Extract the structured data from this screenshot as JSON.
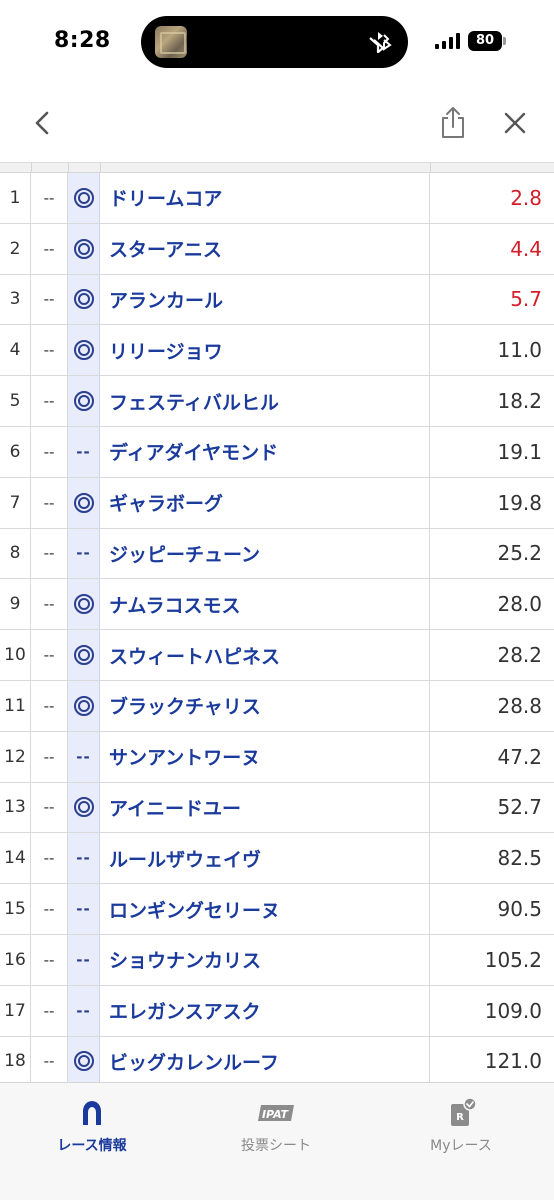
{
  "status_bar": {
    "time": "8:28",
    "battery": "80",
    "island_icons": [
      "media-thumbnail-icon",
      "bluetooth-icon"
    ]
  },
  "nav": {
    "back_icon": "chevron-left-icon",
    "share_icon": "share-icon",
    "close_icon": "close-icon"
  },
  "colors": {
    "name_blue": "#1a3a9c",
    "hot_odds_red": "#d21f2a",
    "mark_column_bg": "#e9ecfa"
  },
  "rows": [
    {
      "num": "1",
      "prev": "--",
      "mark": "double-circle",
      "name": "ドリームコア",
      "odds": "2.8",
      "hot": true
    },
    {
      "num": "2",
      "prev": "--",
      "mark": "double-circle",
      "name": "スターアニス",
      "odds": "4.4",
      "hot": true
    },
    {
      "num": "3",
      "prev": "--",
      "mark": "double-circle",
      "name": "アランカール",
      "odds": "5.7",
      "hot": true
    },
    {
      "num": "4",
      "prev": "--",
      "mark": "double-circle",
      "name": "リリージョワ",
      "odds": "11.0",
      "hot": false
    },
    {
      "num": "5",
      "prev": "--",
      "mark": "double-circle",
      "name": "フェスティバルヒル",
      "odds": "18.2",
      "hot": false
    },
    {
      "num": "6",
      "prev": "--",
      "mark": "dash",
      "mark_text": "--",
      "name": "ディアダイヤモンド",
      "odds": "19.1",
      "hot": false
    },
    {
      "num": "7",
      "prev": "--",
      "mark": "double-circle",
      "name": "ギャラボーグ",
      "odds": "19.8",
      "hot": false
    },
    {
      "num": "8",
      "prev": "--",
      "mark": "dash",
      "mark_text": "--",
      "name": "ジッピーチューン",
      "odds": "25.2",
      "hot": false
    },
    {
      "num": "9",
      "prev": "--",
      "mark": "double-circle",
      "name": "ナムラコスモス",
      "odds": "28.0",
      "hot": false
    },
    {
      "num": "10",
      "prev": "--",
      "mark": "double-circle",
      "name": "スウィートハピネス",
      "odds": "28.2",
      "hot": false
    },
    {
      "num": "11",
      "prev": "--",
      "mark": "double-circle",
      "name": "ブラックチャリス",
      "odds": "28.8",
      "hot": false
    },
    {
      "num": "12",
      "prev": "--",
      "mark": "dash",
      "mark_text": "--",
      "name": "サンアントワーヌ",
      "odds": "47.2",
      "hot": false
    },
    {
      "num": "13",
      "prev": "--",
      "mark": "double-circle",
      "name": "アイニードユー",
      "odds": "52.7",
      "hot": false
    },
    {
      "num": "14",
      "prev": "--",
      "mark": "dash",
      "mark_text": "--",
      "name": "ルールザウェイヴ",
      "odds": "82.5",
      "hot": false
    },
    {
      "num": "15",
      "prev": "--",
      "mark": "dash",
      "mark_text": "--",
      "name": "ロンギングセリーヌ",
      "odds": "90.5",
      "hot": false
    },
    {
      "num": "16",
      "prev": "--",
      "mark": "dash",
      "mark_text": "--",
      "name": "ショウナンカリス",
      "odds": "105.2",
      "hot": false
    },
    {
      "num": "17",
      "prev": "--",
      "mark": "dash",
      "mark_text": "--",
      "name": "エレガンスアスク",
      "odds": "109.0",
      "hot": false
    },
    {
      "num": "18",
      "prev": "--",
      "mark": "double-circle",
      "name": "ビッグカレンルーフ",
      "odds": "121.0",
      "hot": false
    }
  ],
  "tabs": [
    {
      "label": "レース情報",
      "icon": "horseshoe-icon",
      "active": true
    },
    {
      "label": "投票シート",
      "icon": "ipat-icon",
      "icon_text": "IPAT",
      "active": false
    },
    {
      "label": "Myレース",
      "icon": "my-race-icon",
      "icon_text": "R",
      "active": false
    }
  ]
}
